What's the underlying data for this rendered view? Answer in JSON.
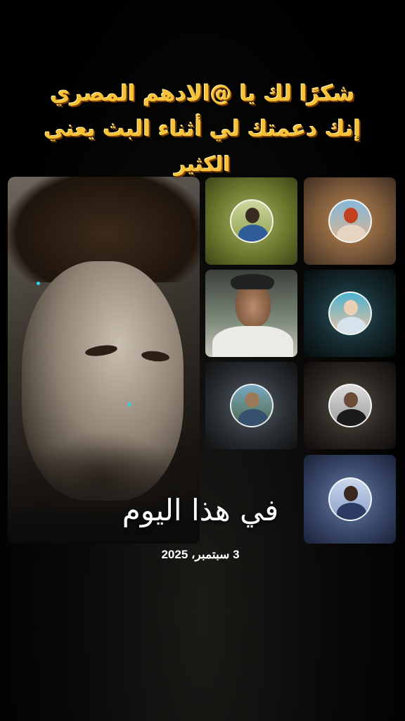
{
  "caption": {
    "line1": "شكرًا لك يا @الادهم المصري",
    "line2": "إنك دعمتك لي أثناء البث يعني",
    "line3": "الكثير"
  },
  "overlay": {
    "today_label": "في هذا اليوم",
    "date": "3 سبتمبر، 2025"
  },
  "colors": {
    "caption_fill": "#f6c238",
    "caption_shadow": "#7a3c00",
    "background": "#000000"
  },
  "collage": {
    "main_photo": "person-portrait",
    "tiles": [
      {
        "name": "supporter-avatar-1"
      },
      {
        "name": "supporter-avatar-2"
      },
      {
        "name": "supporter-photo-3"
      },
      {
        "name": "supporter-avatar-4"
      },
      {
        "name": "supporter-avatar-5"
      },
      {
        "name": "supporter-avatar-6"
      },
      {
        "name": "supporter-avatar-7"
      }
    ]
  }
}
